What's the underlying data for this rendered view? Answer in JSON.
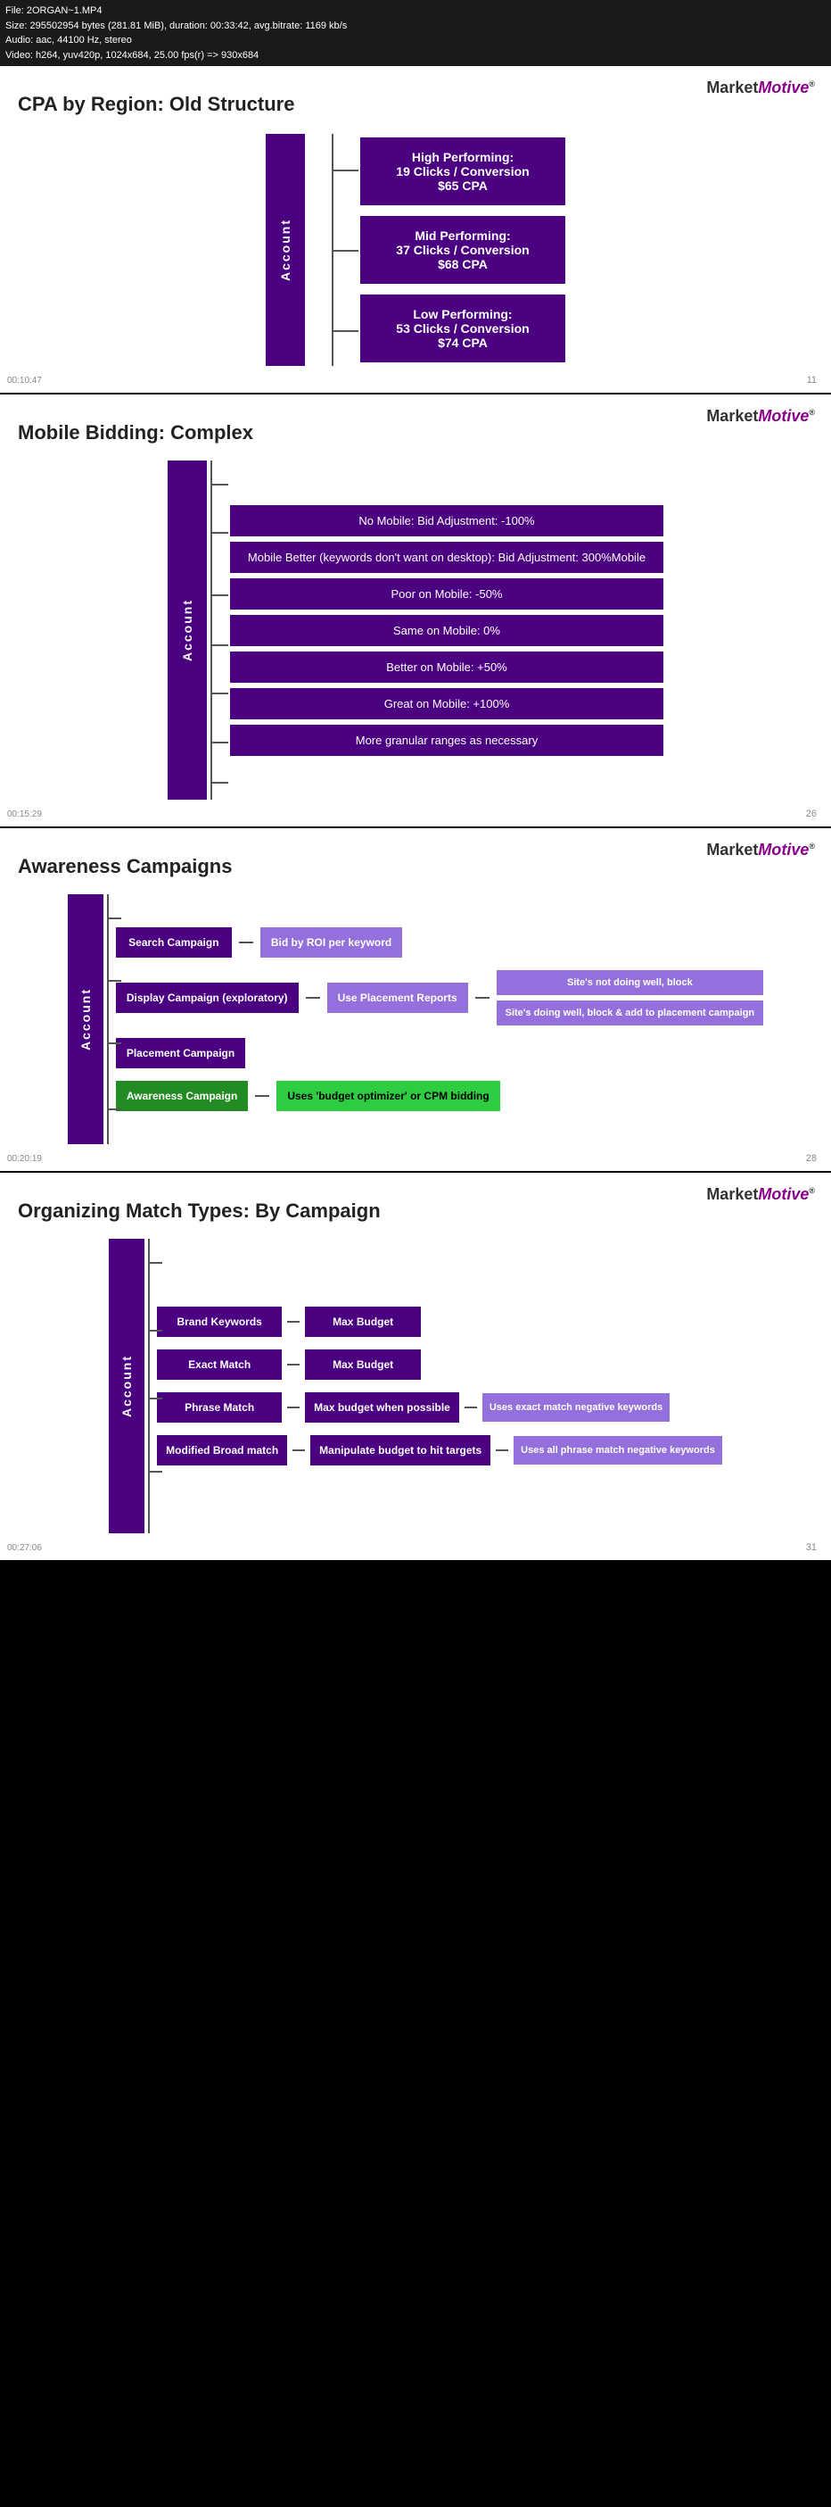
{
  "file_info": {
    "line1": "File: 2ORGAN~1.MP4",
    "line2": "Size: 295502954 bytes (281.81 MiB), duration: 00:33:42, avg.bitrate: 1169 kb/s",
    "line3": "Audio: aac, 44100 Hz, stereo",
    "line4": "Video: h264, yuv420p, 1024x684, 25.00 fps(r) => 930x684"
  },
  "logo": {
    "market": "Market",
    "motive": "Motive",
    "tm": "®"
  },
  "slide1": {
    "title": "CPA by Region: Old Structure",
    "account_label": "Account",
    "boxes": [
      {
        "line1": "High Performing:",
        "line2": "19 Clicks / Conversion",
        "line3": "$65 CPA"
      },
      {
        "line1": "Mid Performing:",
        "line2": "37 Clicks / Conversion",
        "line3": "$68 CPA"
      },
      {
        "line1": "Low Performing:",
        "line2": "53 Clicks / Conversion",
        "line3": "$74 CPA"
      }
    ],
    "slide_number": "11",
    "timestamp": "00:10:47"
  },
  "slide2": {
    "title": "Mobile Bidding: Complex",
    "account_label": "Account",
    "boxes": [
      "No Mobile: Bid Adjustment: -100%",
      "Mobile Better (keywords don't want on desktop): Bid Adjustment: 300%Mobile",
      "Poor on Mobile: -50%",
      "Same on Mobile: 0%",
      "Better on Mobile: +50%",
      "Great on Mobile: +100%",
      "More granular ranges as necessary"
    ],
    "slide_number": "26",
    "timestamp": "00:15:29"
  },
  "slide3": {
    "title": "Awareness Campaigns",
    "account_label": "Account",
    "rows": [
      {
        "left_box": "Search Campaign",
        "right_box": "Bid by ROI per keyword",
        "right_box_type": "light-purple",
        "side_boxes": []
      },
      {
        "left_box": "Display Campaign (exploratory)",
        "right_box": "Use Placement Reports",
        "right_box_type": "light-purple",
        "side_boxes": [
          "Site's not doing well, block",
          "Site's doing well, block & add to placement campaign"
        ]
      },
      {
        "left_box": "Placement Campaign",
        "right_box": "",
        "right_box_type": "none",
        "side_boxes": []
      },
      {
        "left_box": "Awareness Campaign",
        "left_box_type": "green",
        "right_box": "Uses 'budget optimizer' or CPM bidding",
        "right_box_type": "green-right",
        "side_boxes": []
      }
    ],
    "slide_number": "28",
    "timestamp": "00:20:19"
  },
  "slide4": {
    "title": "Organizing Match Types: By Campaign",
    "account_label": "Account",
    "rows": [
      {
        "left_box": "Brand Keywords",
        "right_box": "Max Budget",
        "side_boxes": []
      },
      {
        "left_box": "Exact Match",
        "right_box": "Max Budget",
        "side_boxes": []
      },
      {
        "left_box": "Phrase Match",
        "right_box": "Max budget when possible",
        "side_boxes": [
          "Uses exact match negative keywords"
        ]
      },
      {
        "left_box": "Modified Broad match",
        "right_box": "Manipulate budget to hit targets",
        "side_boxes": [
          "Uses all phrase match negative keywords"
        ]
      }
    ],
    "slide_number": "31",
    "timestamp": "00:27:06"
  }
}
